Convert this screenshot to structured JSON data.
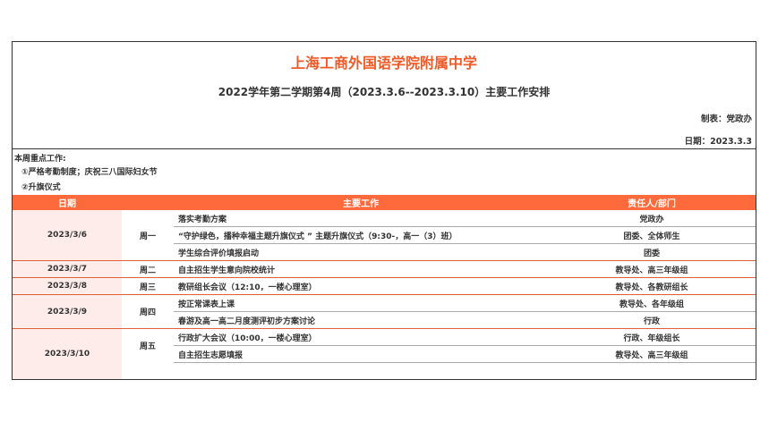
{
  "school_name": "上海工商外国语学院附属中学",
  "subtitle": "2022学年第二学期第4周（2023.3.6--2023.3.10）主要工作安排",
  "maker": "制表：党政办",
  "date_line": "日期：2023.3.3",
  "focus": {
    "heading": "本周重点工作:",
    "items": [
      "①严格考勤制度；庆祝三八国际妇女节",
      "②升旗仪式"
    ]
  },
  "table": {
    "headers": {
      "date": "日期",
      "work": "主要工作",
      "responsible": "责任人/部门"
    },
    "days": [
      {
        "date": "2023/3/6",
        "weekday": "周一",
        "tasks": [
          {
            "work": "落实考勤方案",
            "responsible": "党政办"
          },
          {
            "work": "“守护绿色，播种幸福主题升旗仪式 ” 主题升旗仪式（9:30-，高一（3）班）",
            "responsible": "团委、全体师生"
          },
          {
            "work": "学生综合评价填报启动",
            "responsible": "团委"
          }
        ]
      },
      {
        "date": "2023/3/7",
        "weekday": "周二",
        "tasks": [
          {
            "work": "自主招生学生意向院校统计",
            "responsible": "教导处、高三年级组"
          }
        ]
      },
      {
        "date": "2023/3/8",
        "weekday": "周三",
        "tasks": [
          {
            "work": "教研组长会议（12:10，一楼心理室）",
            "responsible": "教导处、各教研组长"
          }
        ]
      },
      {
        "date": "2023/3/9",
        "weekday": "周四",
        "tasks": [
          {
            "work": "按正常课表上课",
            "responsible": "教导处、各年级组"
          },
          {
            "work": "春游及高一高二月度测评初步方案讨论",
            "responsible": "行政"
          }
        ]
      },
      {
        "date": "2023/3/10",
        "weekday": "周五",
        "tasks": [
          {
            "work": "行政扩大会议（10:00，一楼心理室）",
            "responsible": "行政、年级组长"
          },
          {
            "work": "自主招生志愿填报",
            "responsible": "教导处、高三年级组"
          }
        ]
      }
    ]
  }
}
